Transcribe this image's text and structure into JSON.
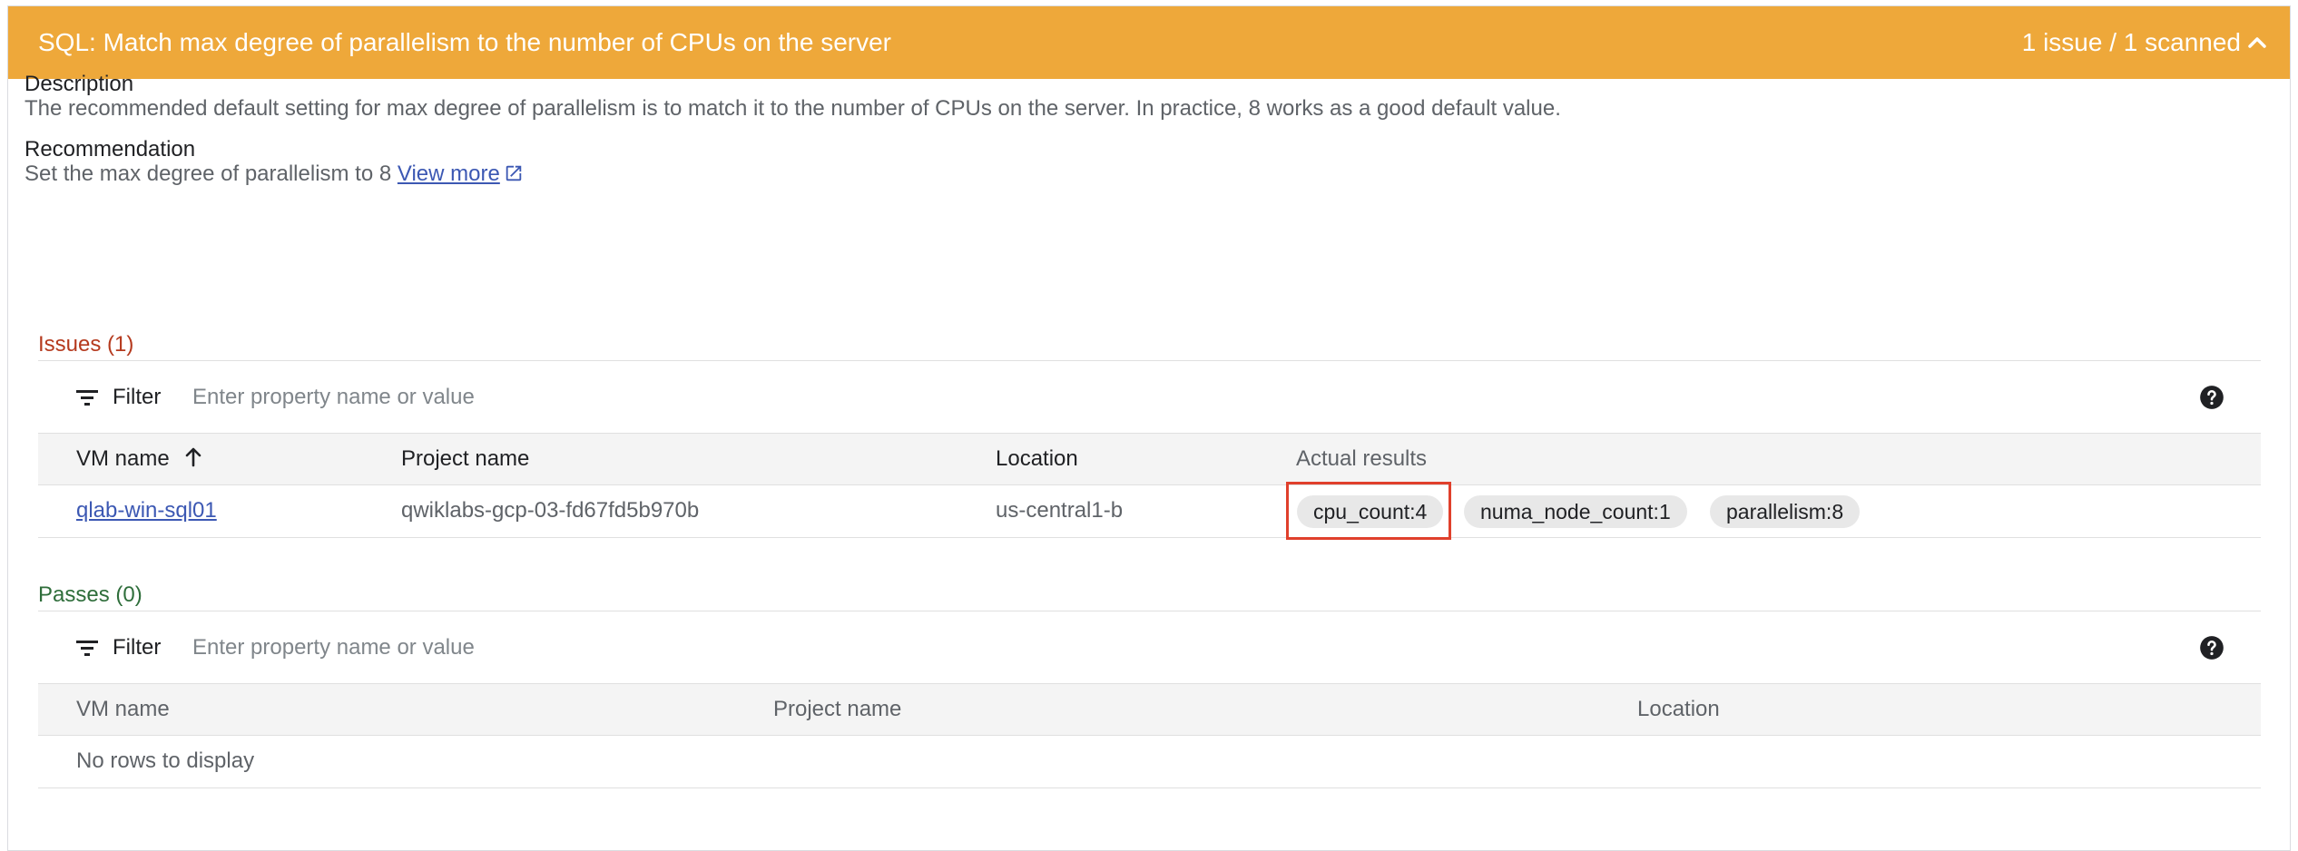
{
  "header": {
    "title": "SQL: Match max degree of parallelism to the number of CPUs on the server",
    "status": "1 issue / 1 scanned"
  },
  "description": {
    "label": "Description",
    "text": "The recommended default setting for max degree of parallelism is to match it to the number of CPUs on the server. In practice, 8 works as a good default value."
  },
  "recommendation": {
    "label": "Recommendation",
    "text": "Set the max degree of parallelism to 8",
    "link_text": "View more"
  },
  "issues": {
    "heading": "Issues (1)",
    "filter_label": "Filter",
    "filter_placeholder": "Enter property name or value",
    "columns": [
      "VM name",
      "Project name",
      "Location",
      "Actual results"
    ],
    "rows": [
      {
        "vm_name": "qlab-win-sql01",
        "project_name": "qwiklabs-gcp-03-fd67fd5b970b",
        "location": "us-central1-b",
        "results": [
          "cpu_count:4",
          "numa_node_count:1",
          "parallelism:8"
        ]
      }
    ]
  },
  "passes": {
    "heading": "Passes (0)",
    "filter_label": "Filter",
    "filter_placeholder": "Enter property name or value",
    "columns": [
      "VM name",
      "Project name",
      "Location"
    ],
    "empty_text": "No rows to display"
  },
  "colors": {
    "header_bg": "#eea83a",
    "issues": "#b53a1e",
    "passes": "#2f6e3b",
    "link": "#3c58b3",
    "highlight": "#e0402c"
  },
  "icons": {
    "collapse": "chevron-up-icon",
    "external": "external-link-icon",
    "filter": "filter-icon",
    "help": "help-icon",
    "sort": "arrow-up-icon"
  }
}
